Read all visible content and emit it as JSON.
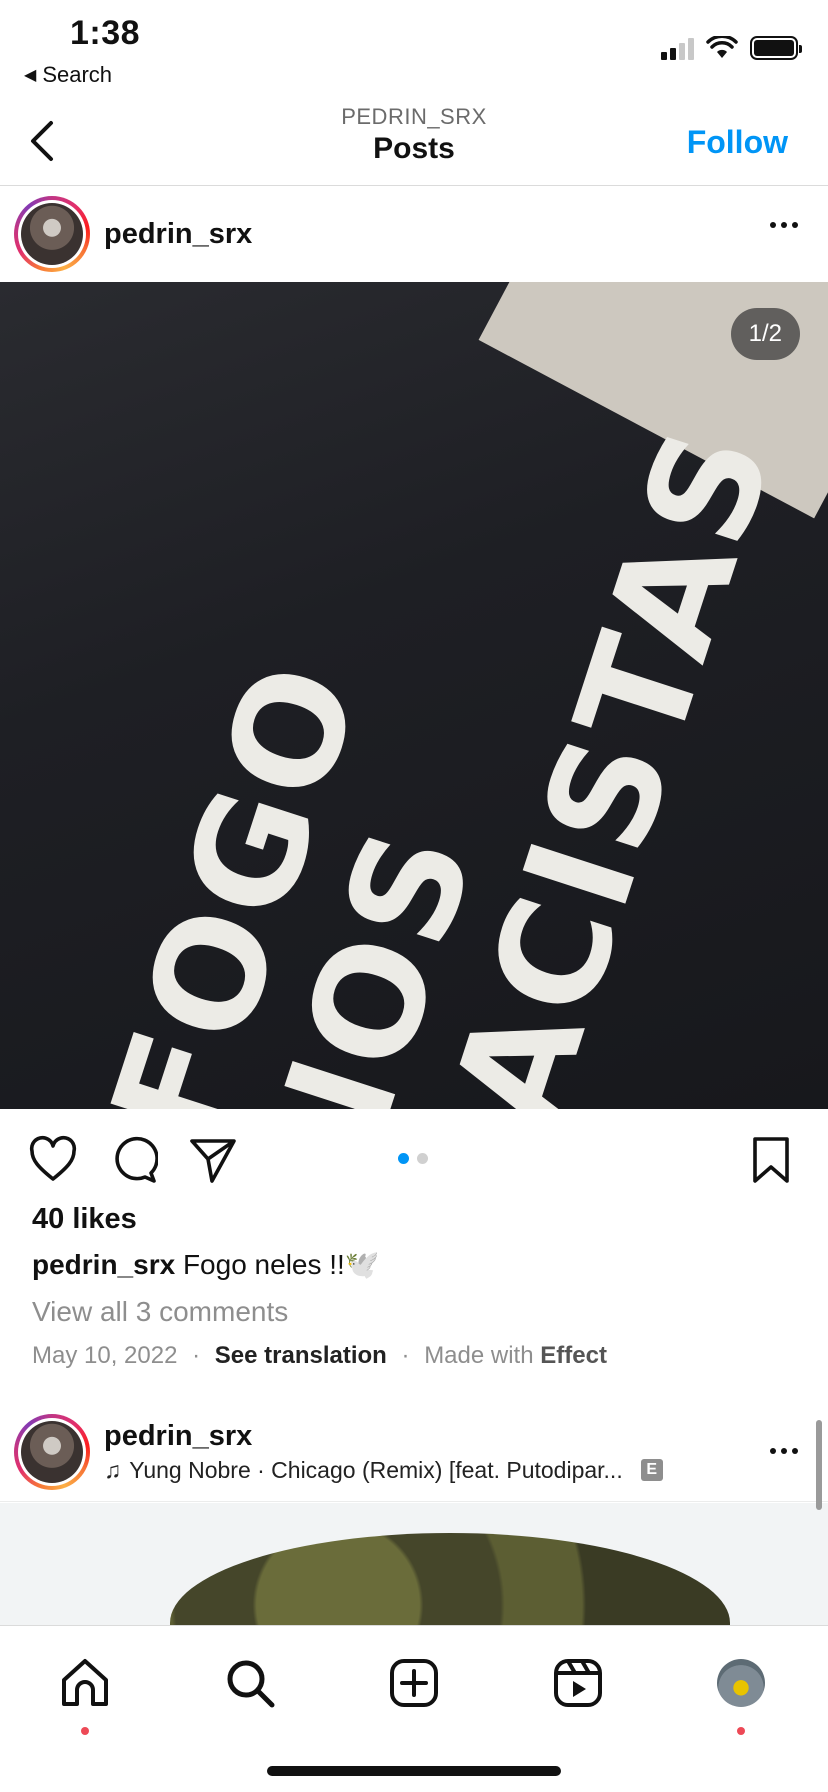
{
  "status_bar": {
    "time": "1:38",
    "back_label": "Search",
    "back_arrow": "◀"
  },
  "header": {
    "subtitle": "PEDRIN_SRX",
    "title": "Posts",
    "follow_label": "Follow"
  },
  "post1": {
    "username": "pedrin_srx",
    "photo_text": "FOGO\nNOS\nRACISTAS",
    "counter": "1/2",
    "likes": "40 likes",
    "caption_user": "pedrin_srx",
    "caption_text": "Fogo neles !!🕊️",
    "view_comments": "View all 3 comments",
    "date": "May 10, 2022",
    "sep1": "·",
    "see_translation": "See translation",
    "sep2": "·",
    "made_with": "Made with",
    "effect": "Effect"
  },
  "post2": {
    "username": "pedrin_srx",
    "music_note": "♫",
    "music": "Yung Nobre · Chicago (Remix) [feat. Putodipar...",
    "explicit": "E"
  },
  "colors": {
    "accent": "#0095f6",
    "notification": "#ed4956",
    "secondary_text": "#8e8e8e"
  },
  "tabbar": {
    "items": [
      "home-icon",
      "search-icon",
      "create-icon",
      "reels-icon",
      "profile-avatar"
    ]
  }
}
